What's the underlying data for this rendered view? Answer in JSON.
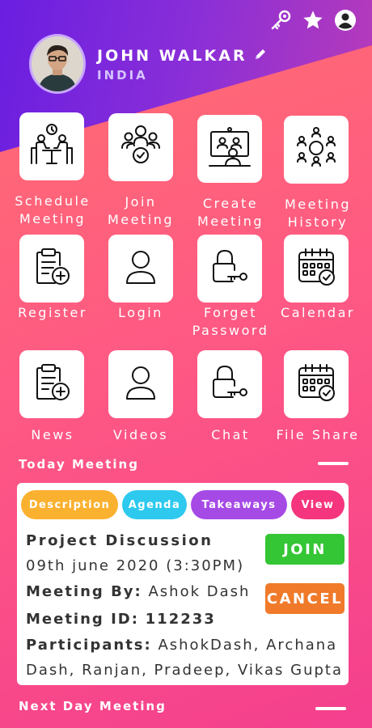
{
  "profile": {
    "name": "JOHN WALKAR",
    "country": "INDIA"
  },
  "top_icons": [
    "key-icon",
    "star-icon",
    "user-account-icon"
  ],
  "grid": [
    {
      "label": "Schedule\nMeeting",
      "icon": "meeting-table-icon"
    },
    {
      "label": "Join\nMeeting",
      "icon": "group-check-icon"
    },
    {
      "label": "Create\nMeeting",
      "icon": "video-presentation-icon"
    },
    {
      "label": "Meeting\nHistory",
      "icon": "people-circle-icon"
    },
    {
      "label": "Register",
      "icon": "clipboard-add-icon"
    },
    {
      "label": "Login",
      "icon": "user-icon"
    },
    {
      "label": "Forget\nPassword",
      "icon": "lock-key-icon"
    },
    {
      "label": "Calendar",
      "icon": "calendar-check-icon"
    },
    {
      "label": "News",
      "icon": "clipboard-add-icon"
    },
    {
      "label": "Videos",
      "icon": "user-icon"
    },
    {
      "label": "Chat",
      "icon": "lock-key-icon"
    },
    {
      "label": "File Share",
      "icon": "calendar-check-icon"
    }
  ],
  "today": {
    "title": "Today Meeting",
    "tabs": [
      {
        "label": "Description",
        "color": "#fbb130"
      },
      {
        "label": "Agenda",
        "color": "#2ec9ee"
      },
      {
        "label": "Takeaways",
        "color": "#a64ae6"
      },
      {
        "label": "View",
        "color": "#f5357d"
      }
    ],
    "meeting_title": "Project Discussion",
    "date": "09th june 2020 (3:30PM)",
    "by_label": "Meeting By:",
    "by_value": "Ashok Dash",
    "id_label": "Meeting ID:",
    "id_value": "112233",
    "participants_label": "Participants:",
    "participants_line1": "AshokDash, Archana",
    "participants_line2": "Dash, Ranjan, Pradeep, Vikas Gupta",
    "join_label": "JOIN",
    "join_color": "#34c634",
    "cancel_label": "CANCEL",
    "cancel_color": "#f07a2a"
  },
  "next_day": {
    "title": "Next Day Meeting"
  }
}
